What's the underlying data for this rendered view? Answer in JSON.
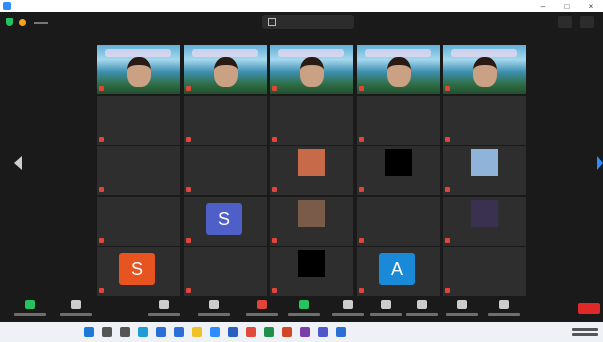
{
  "colors": {
    "background": "#1a1a1a",
    "tile": "#2e2e2e",
    "muted_mic": "#e0453a",
    "end_button": "#e02828",
    "accent": "#2d8cff"
  },
  "gallery": {
    "tiles": [
      {
        "type": "video",
        "name": ""
      },
      {
        "type": "video",
        "name": ""
      },
      {
        "type": "video",
        "name": ""
      },
      {
        "type": "video",
        "name": ""
      },
      {
        "type": "video",
        "name": ""
      },
      {
        "type": "name",
        "name": ""
      },
      {
        "type": "name",
        "name": ""
      },
      {
        "type": "name",
        "name": ""
      },
      {
        "type": "name",
        "name": ""
      },
      {
        "type": "name",
        "name": ""
      },
      {
        "type": "name",
        "name": ""
      },
      {
        "type": "name",
        "name": ""
      },
      {
        "type": "pic",
        "picture": "pixel-character",
        "pic_color": "#c76a4a"
      },
      {
        "type": "pic",
        "picture": "black",
        "pic_color": "#000000"
      },
      {
        "type": "pic",
        "picture": "sky-image",
        "pic_color": "#8fb3d9"
      },
      {
        "type": "name",
        "name": ""
      },
      {
        "type": "avatar",
        "letter": "S",
        "color": "#4f5fc8"
      },
      {
        "type": "pic",
        "picture": "portrait",
        "pic_color": "#7a5a48"
      },
      {
        "type": "name",
        "name": ""
      },
      {
        "type": "pic",
        "picture": "illustration",
        "pic_color": "#3a3050"
      },
      {
        "type": "avatar",
        "letter": "S",
        "color": "#e8541f"
      },
      {
        "type": "name",
        "name": ""
      },
      {
        "type": "pic",
        "picture": "black",
        "pic_color": "#000000"
      },
      {
        "type": "avatar",
        "letter": "A",
        "color": "#1a8ad8"
      },
      {
        "type": "name",
        "name": ""
      }
    ]
  },
  "toolbar": {
    "buttons": [
      {
        "icon": "mic-icon",
        "color": "#25c35b"
      },
      {
        "icon": "video-icon",
        "color": "#cccccc"
      },
      {
        "icon": "security-icon",
        "color": "#cccccc"
      },
      {
        "icon": "participants-icon",
        "color": "#cccccc"
      },
      {
        "icon": "chat-icon",
        "color": "#e0453a"
      },
      {
        "icon": "share-screen-icon",
        "color": "#25c35b"
      },
      {
        "icon": "record-icon",
        "color": "#cccccc"
      },
      {
        "icon": "reactions-icon",
        "color": "#cccccc"
      },
      {
        "icon": "apps-icon",
        "color": "#cccccc"
      },
      {
        "icon": "whiteboard-icon",
        "color": "#cccccc"
      },
      {
        "icon": "more-icon",
        "color": "#cccccc"
      }
    ]
  },
  "taskbar": {
    "icons": [
      {
        "icon": "start-icon",
        "color": "#1e78d6"
      },
      {
        "icon": "search-icon",
        "color": "#555555"
      },
      {
        "icon": "task-view-icon",
        "color": "#555555"
      },
      {
        "icon": "edge-icon",
        "color": "#1f9cd8"
      },
      {
        "icon": "store-icon",
        "color": "#2a6ed6"
      },
      {
        "icon": "mail-icon",
        "color": "#2a6ed6"
      },
      {
        "icon": "explorer-icon",
        "color": "#f0c028"
      },
      {
        "icon": "zoom-icon",
        "color": "#2d8cff"
      },
      {
        "icon": "word-icon",
        "color": "#2b5fbf"
      },
      {
        "icon": "chrome-icon",
        "color": "#e04a3a"
      },
      {
        "icon": "excel-icon",
        "color": "#1f8f4a"
      },
      {
        "icon": "powerpoint-icon",
        "color": "#d24726"
      },
      {
        "icon": "onenote-icon",
        "color": "#7a3fa8"
      },
      {
        "icon": "teams-icon",
        "color": "#5059c9"
      },
      {
        "icon": "photos-icon",
        "color": "#2a6ed6"
      }
    ]
  }
}
